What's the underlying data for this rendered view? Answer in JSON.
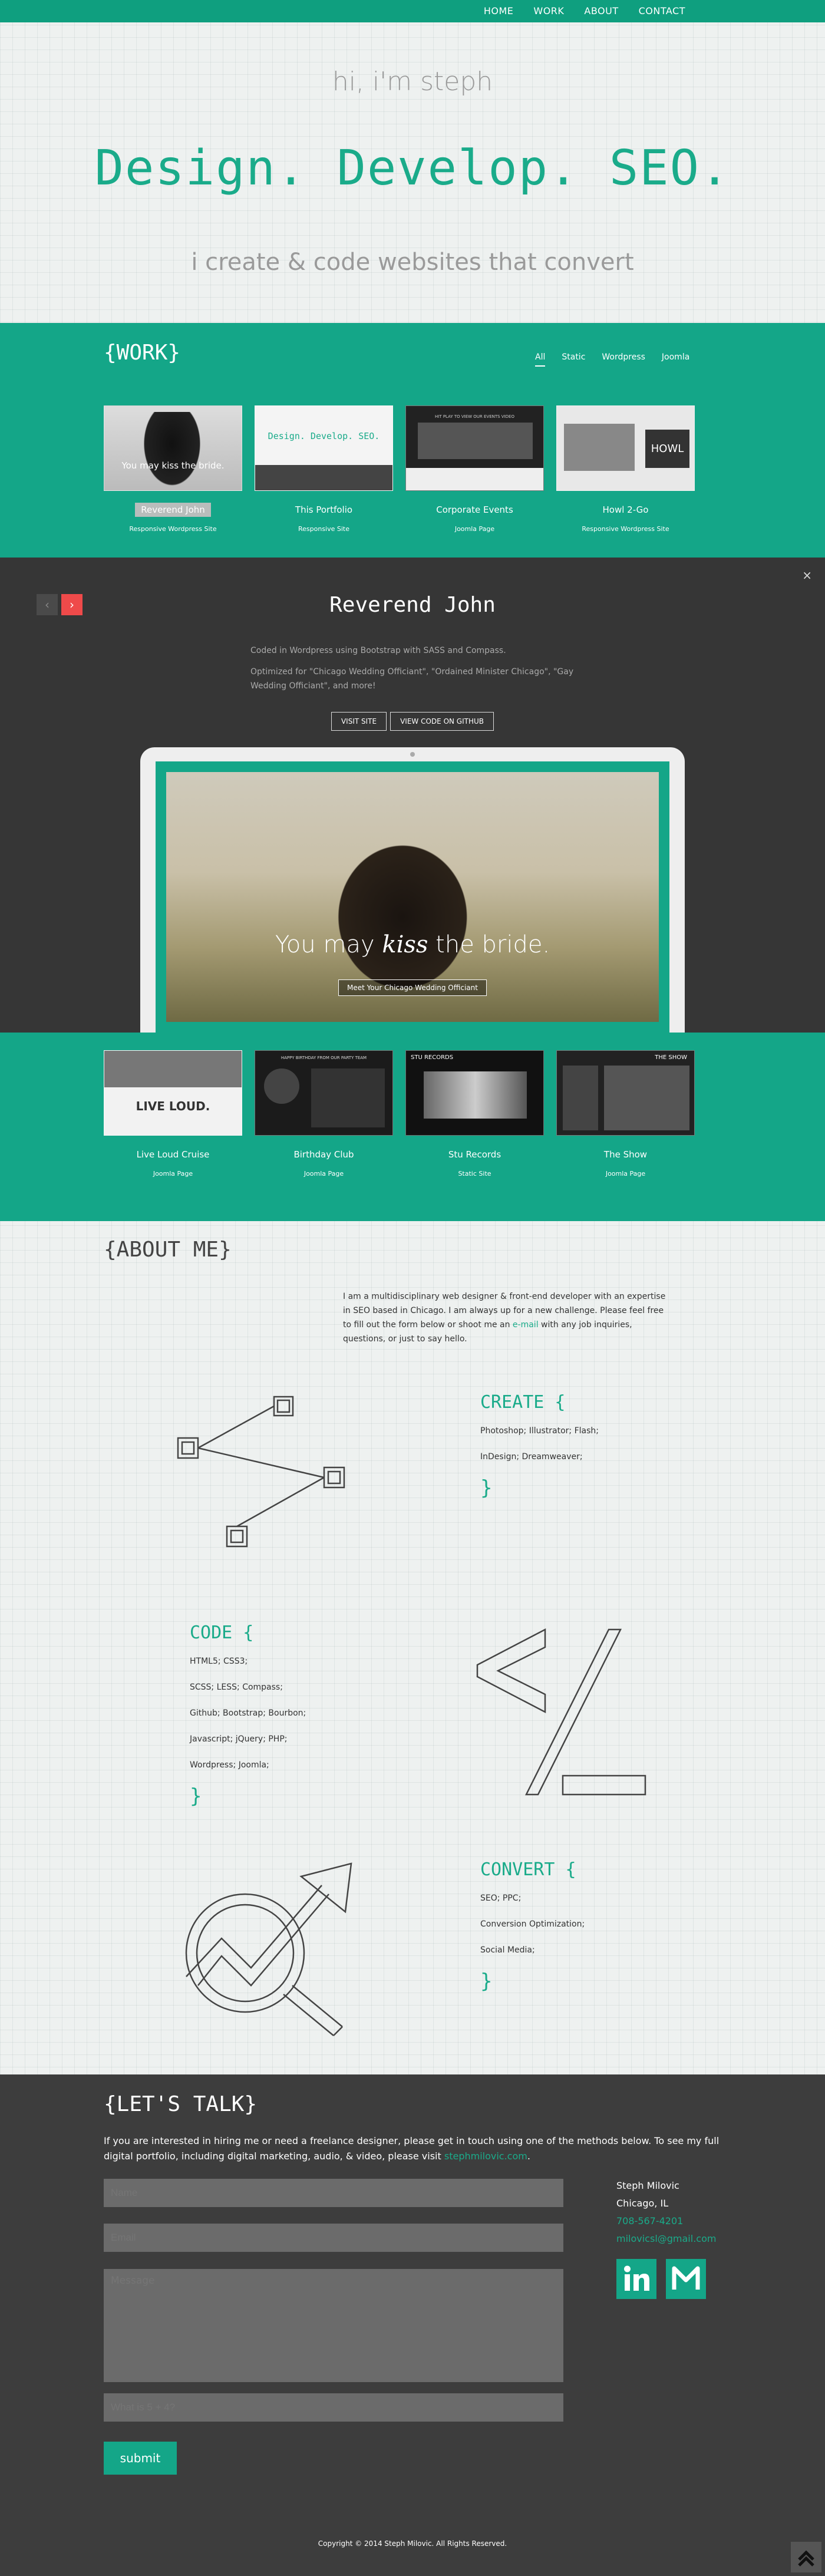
{
  "nav": {
    "items": [
      "HOME",
      "WORK",
      "ABOUT",
      "CONTACT"
    ]
  },
  "hero": {
    "greeting": "hi, i'm steph",
    "headline": "Design. Develop. SEO.",
    "tagline": "i create & code websites that convert"
  },
  "work": {
    "title": "{WORK}",
    "filters": [
      "All",
      "Static",
      "Wordpress",
      "Joomla"
    ],
    "active_filter": "All",
    "items": [
      {
        "title": "Reverend John",
        "type": "Responsive Wordpress Site",
        "thumb_text": "You may kiss the bride."
      },
      {
        "title": "This Portfolio",
        "type": "Responsive Site",
        "thumb_text": "Design. Develop. SEO."
      },
      {
        "title": "Corporate Events",
        "type": "Joomla Page",
        "thumb_text": "HIT PLAY TO VIEW OUR EVENTS VIDEO"
      },
      {
        "title": "Howl 2-Go",
        "type": "Responsive Wordpress Site",
        "thumb_text": "HOWL"
      }
    ],
    "items2": [
      {
        "title": "Live Loud Cruise",
        "type": "Joomla Page",
        "thumb_text": "LIVE LOUD."
      },
      {
        "title": "Birthday Club",
        "type": "Joomla Page",
        "thumb_text": "HAPPY BIRTHDAY FROM OUR PARTY TEAM"
      },
      {
        "title": "Stu Records",
        "type": "Static Site",
        "thumb_text": "STU RECORDS"
      },
      {
        "title": "The Show",
        "type": "Joomla Page",
        "thumb_text": "THE SHOW"
      }
    ]
  },
  "detail": {
    "title": "Reverend John",
    "close": "×",
    "prev": "‹",
    "next": "›",
    "desc1": "Coded in Wordpress using Bootstrap with SASS and Compass.",
    "desc2": "Optimized for \"Chicago Wedding Officiant\", \"Ordained Minister Chicago\", \"Gay Wedding Officiant\", and more!",
    "visit_label": "VISIT SITE",
    "github_label": "VIEW CODE ON GITHUB",
    "screen_tag_pre": "You may ",
    "screen_tag_em": "kiss",
    "screen_tag_post": " the bride.",
    "screen_cta": "Meet Your Chicago Wedding Officiant"
  },
  "about": {
    "title": "{ABOUT ME}",
    "intro_pre": "I am a multidisciplinary web designer & front-end developer with an expertise in SEO based in Chicago. I am always up for a new challenge. Please feel free to fill out the form below or shoot me an ",
    "intro_link": "e-mail",
    "intro_post": " with any job inquiries, questions, or just to say hello.",
    "create": {
      "heading": "CREATE {",
      "lines": [
        "Photoshop; Illustrator; Flash;",
        "InDesign; Dreamweaver;"
      ],
      "close": "}"
    },
    "code": {
      "heading": "CODE {",
      "lines": [
        "HTML5; CSS3;",
        "SCSS; LESS; Compass;",
        "Github; Bootstrap; Bourbon;",
        "Javascript; jQuery; PHP;",
        "Wordpress; Joomla;"
      ],
      "close": "}"
    },
    "convert": {
      "heading": "CONVERT {",
      "lines": [
        "SEO; PPC;",
        "Conversion Optimization;",
        "Social Media;"
      ],
      "close": "}"
    }
  },
  "talk": {
    "title": "{LET'S TALK}",
    "lead_pre": "If you are interested in hiring me or need a freelance designer, please get in touch using one of the methods below. To see my full digital portfolio, including digital marketing, audio, & video, please visit ",
    "lead_link": "stephmilovic.com",
    "lead_post": ".",
    "name_placeholder": "Name",
    "email_placeholder": "Email",
    "message_placeholder": "Message",
    "captcha_placeholder": "What is 5 + 4?",
    "submit_label": "submit",
    "contact_name": "Steph Milovic",
    "contact_city": "Chicago, IL",
    "contact_phone": "708-567-4201",
    "contact_email": "milovicsl@gmail.com",
    "social": [
      "linkedin-icon",
      "gmail-icon"
    ]
  },
  "footer": {
    "copyright": "Copyright © 2014 Steph Milovic. All Rights Reserved."
  },
  "colors": {
    "accent": "#14a688",
    "dark": "#363636",
    "talk_bg": "#3d3d3d",
    "next_arrow": "#ef4a4a"
  }
}
